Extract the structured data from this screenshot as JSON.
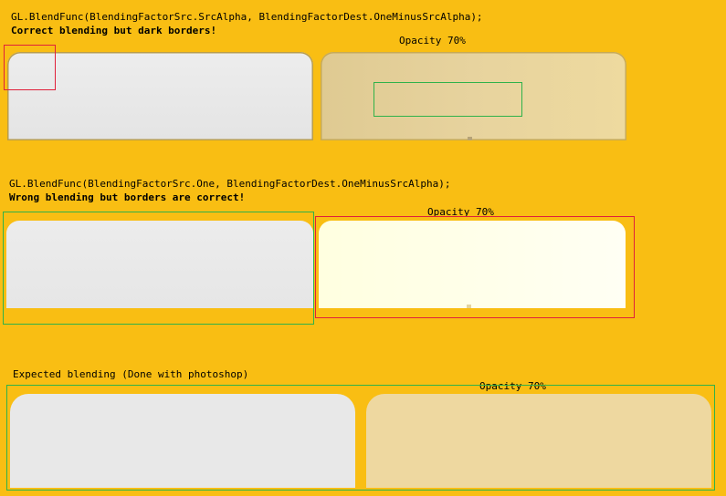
{
  "section1": {
    "code": "GL.BlendFunc(BlendingFactorSrc.SrcAlpha, BlendingFactorDest.OneMinusSrcAlpha);",
    "caption": "Correct blending but dark borders!",
    "opacity_label": "Opacity 70%"
  },
  "section2": {
    "code": "GL.BlendFunc(BlendingFactorSrc.One, BlendingFactorDest.OneMinusSrcAlpha);",
    "caption": "Wrong blending but borders are correct!",
    "opacity_label": "Opacity 70%"
  },
  "section3": {
    "caption": "Expected blending (Done with photoshop)",
    "opacity_label": "Opacity 70%"
  },
  "colors": {
    "background": "#f9be13",
    "highlight_red": "#e0203a",
    "highlight_green": "#2fb24a"
  }
}
